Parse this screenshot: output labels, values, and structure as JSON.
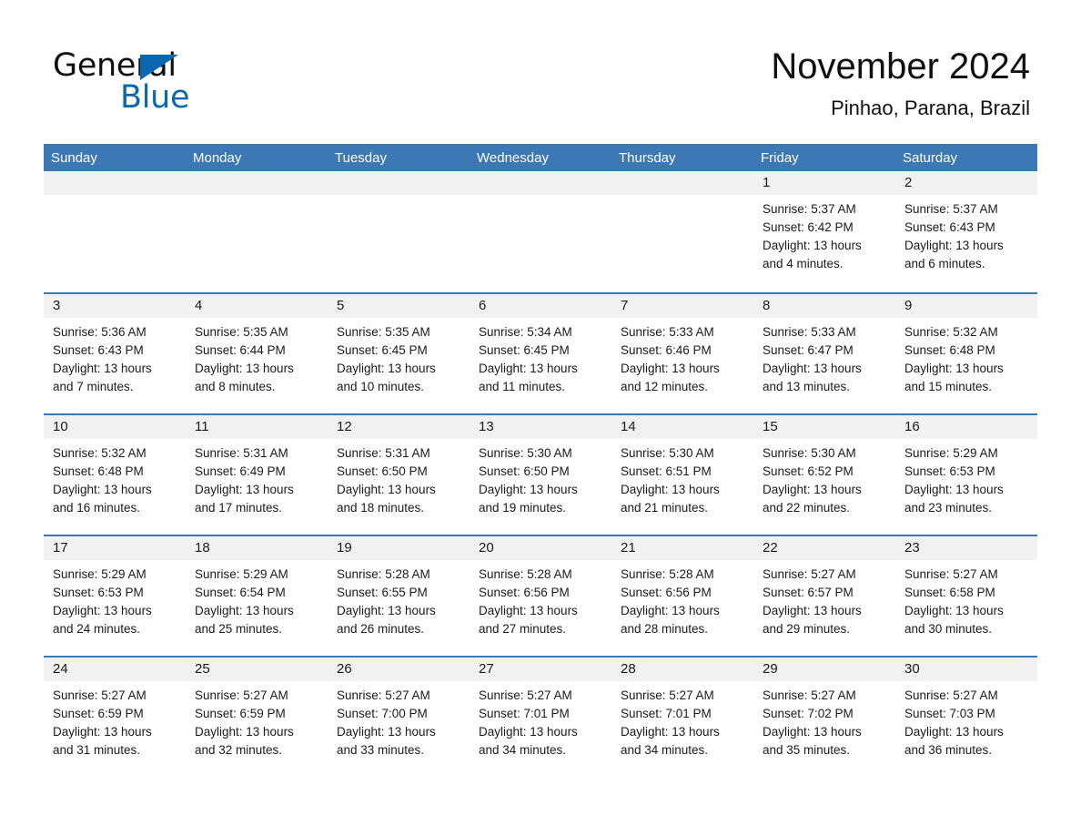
{
  "logo": {
    "word_general": "General",
    "word_blue": "Blue",
    "triangle_color": "#0b68b0"
  },
  "header": {
    "title": "November 2024",
    "subtitle": "Pinhao, Parana, Brazil"
  },
  "theme": {
    "header_blue": "#3b78b4",
    "daynum_band": "#f2f2f2",
    "text": "#1a1a1a"
  },
  "weekday_headers": [
    "Sunday",
    "Monday",
    "Tuesday",
    "Wednesday",
    "Thursday",
    "Friday",
    "Saturday"
  ],
  "labels": {
    "sunrise_prefix": "Sunrise:",
    "sunset_prefix": "Sunset:",
    "daylight_prefix": "Daylight:"
  },
  "weeks": [
    [
      {
        "day": "",
        "sunrise": "",
        "sunset": "",
        "daylight_1": "",
        "daylight_2": "",
        "blank": true
      },
      {
        "day": "",
        "sunrise": "",
        "sunset": "",
        "daylight_1": "",
        "daylight_2": "",
        "blank": true
      },
      {
        "day": "",
        "sunrise": "",
        "sunset": "",
        "daylight_1": "",
        "daylight_2": "",
        "blank": true
      },
      {
        "day": "",
        "sunrise": "",
        "sunset": "",
        "daylight_1": "",
        "daylight_2": "",
        "blank": true
      },
      {
        "day": "",
        "sunrise": "",
        "sunset": "",
        "daylight_1": "",
        "daylight_2": "",
        "blank": true
      },
      {
        "day": "1",
        "sunrise": "Sunrise: 5:37 AM",
        "sunset": "Sunset: 6:42 PM",
        "daylight_1": "Daylight: 13 hours",
        "daylight_2": "and 4 minutes.",
        "blank": false
      },
      {
        "day": "2",
        "sunrise": "Sunrise: 5:37 AM",
        "sunset": "Sunset: 6:43 PM",
        "daylight_1": "Daylight: 13 hours",
        "daylight_2": "and 6 minutes.",
        "blank": false
      }
    ],
    [
      {
        "day": "3",
        "sunrise": "Sunrise: 5:36 AM",
        "sunset": "Sunset: 6:43 PM",
        "daylight_1": "Daylight: 13 hours",
        "daylight_2": "and 7 minutes.",
        "blank": false
      },
      {
        "day": "4",
        "sunrise": "Sunrise: 5:35 AM",
        "sunset": "Sunset: 6:44 PM",
        "daylight_1": "Daylight: 13 hours",
        "daylight_2": "and 8 minutes.",
        "blank": false
      },
      {
        "day": "5",
        "sunrise": "Sunrise: 5:35 AM",
        "sunset": "Sunset: 6:45 PM",
        "daylight_1": "Daylight: 13 hours",
        "daylight_2": "and 10 minutes.",
        "blank": false
      },
      {
        "day": "6",
        "sunrise": "Sunrise: 5:34 AM",
        "sunset": "Sunset: 6:45 PM",
        "daylight_1": "Daylight: 13 hours",
        "daylight_2": "and 11 minutes.",
        "blank": false
      },
      {
        "day": "7",
        "sunrise": "Sunrise: 5:33 AM",
        "sunset": "Sunset: 6:46 PM",
        "daylight_1": "Daylight: 13 hours",
        "daylight_2": "and 12 minutes.",
        "blank": false
      },
      {
        "day": "8",
        "sunrise": "Sunrise: 5:33 AM",
        "sunset": "Sunset: 6:47 PM",
        "daylight_1": "Daylight: 13 hours",
        "daylight_2": "and 13 minutes.",
        "blank": false
      },
      {
        "day": "9",
        "sunrise": "Sunrise: 5:32 AM",
        "sunset": "Sunset: 6:48 PM",
        "daylight_1": "Daylight: 13 hours",
        "daylight_2": "and 15 minutes.",
        "blank": false
      }
    ],
    [
      {
        "day": "10",
        "sunrise": "Sunrise: 5:32 AM",
        "sunset": "Sunset: 6:48 PM",
        "daylight_1": "Daylight: 13 hours",
        "daylight_2": "and 16 minutes.",
        "blank": false
      },
      {
        "day": "11",
        "sunrise": "Sunrise: 5:31 AM",
        "sunset": "Sunset: 6:49 PM",
        "daylight_1": "Daylight: 13 hours",
        "daylight_2": "and 17 minutes.",
        "blank": false
      },
      {
        "day": "12",
        "sunrise": "Sunrise: 5:31 AM",
        "sunset": "Sunset: 6:50 PM",
        "daylight_1": "Daylight: 13 hours",
        "daylight_2": "and 18 minutes.",
        "blank": false
      },
      {
        "day": "13",
        "sunrise": "Sunrise: 5:30 AM",
        "sunset": "Sunset: 6:50 PM",
        "daylight_1": "Daylight: 13 hours",
        "daylight_2": "and 19 minutes.",
        "blank": false
      },
      {
        "day": "14",
        "sunrise": "Sunrise: 5:30 AM",
        "sunset": "Sunset: 6:51 PM",
        "daylight_1": "Daylight: 13 hours",
        "daylight_2": "and 21 minutes.",
        "blank": false
      },
      {
        "day": "15",
        "sunrise": "Sunrise: 5:30 AM",
        "sunset": "Sunset: 6:52 PM",
        "daylight_1": "Daylight: 13 hours",
        "daylight_2": "and 22 minutes.",
        "blank": false
      },
      {
        "day": "16",
        "sunrise": "Sunrise: 5:29 AM",
        "sunset": "Sunset: 6:53 PM",
        "daylight_1": "Daylight: 13 hours",
        "daylight_2": "and 23 minutes.",
        "blank": false
      }
    ],
    [
      {
        "day": "17",
        "sunrise": "Sunrise: 5:29 AM",
        "sunset": "Sunset: 6:53 PM",
        "daylight_1": "Daylight: 13 hours",
        "daylight_2": "and 24 minutes.",
        "blank": false
      },
      {
        "day": "18",
        "sunrise": "Sunrise: 5:29 AM",
        "sunset": "Sunset: 6:54 PM",
        "daylight_1": "Daylight: 13 hours",
        "daylight_2": "and 25 minutes.",
        "blank": false
      },
      {
        "day": "19",
        "sunrise": "Sunrise: 5:28 AM",
        "sunset": "Sunset: 6:55 PM",
        "daylight_1": "Daylight: 13 hours",
        "daylight_2": "and 26 minutes.",
        "blank": false
      },
      {
        "day": "20",
        "sunrise": "Sunrise: 5:28 AM",
        "sunset": "Sunset: 6:56 PM",
        "daylight_1": "Daylight: 13 hours",
        "daylight_2": "and 27 minutes.",
        "blank": false
      },
      {
        "day": "21",
        "sunrise": "Sunrise: 5:28 AM",
        "sunset": "Sunset: 6:56 PM",
        "daylight_1": "Daylight: 13 hours",
        "daylight_2": "and 28 minutes.",
        "blank": false
      },
      {
        "day": "22",
        "sunrise": "Sunrise: 5:27 AM",
        "sunset": "Sunset: 6:57 PM",
        "daylight_1": "Daylight: 13 hours",
        "daylight_2": "and 29 minutes.",
        "blank": false
      },
      {
        "day": "23",
        "sunrise": "Sunrise: 5:27 AM",
        "sunset": "Sunset: 6:58 PM",
        "daylight_1": "Daylight: 13 hours",
        "daylight_2": "and 30 minutes.",
        "blank": false
      }
    ],
    [
      {
        "day": "24",
        "sunrise": "Sunrise: 5:27 AM",
        "sunset": "Sunset: 6:59 PM",
        "daylight_1": "Daylight: 13 hours",
        "daylight_2": "and 31 minutes.",
        "blank": false
      },
      {
        "day": "25",
        "sunrise": "Sunrise: 5:27 AM",
        "sunset": "Sunset: 6:59 PM",
        "daylight_1": "Daylight: 13 hours",
        "daylight_2": "and 32 minutes.",
        "blank": false
      },
      {
        "day": "26",
        "sunrise": "Sunrise: 5:27 AM",
        "sunset": "Sunset: 7:00 PM",
        "daylight_1": "Daylight: 13 hours",
        "daylight_2": "and 33 minutes.",
        "blank": false
      },
      {
        "day": "27",
        "sunrise": "Sunrise: 5:27 AM",
        "sunset": "Sunset: 7:01 PM",
        "daylight_1": "Daylight: 13 hours",
        "daylight_2": "and 34 minutes.",
        "blank": false
      },
      {
        "day": "28",
        "sunrise": "Sunrise: 5:27 AM",
        "sunset": "Sunset: 7:01 PM",
        "daylight_1": "Daylight: 13 hours",
        "daylight_2": "and 34 minutes.",
        "blank": false
      },
      {
        "day": "29",
        "sunrise": "Sunrise: 5:27 AM",
        "sunset": "Sunset: 7:02 PM",
        "daylight_1": "Daylight: 13 hours",
        "daylight_2": "and 35 minutes.",
        "blank": false
      },
      {
        "day": "30",
        "sunrise": "Sunrise: 5:27 AM",
        "sunset": "Sunset: 7:03 PM",
        "daylight_1": "Daylight: 13 hours",
        "daylight_2": "and 36 minutes.",
        "blank": false
      }
    ]
  ]
}
